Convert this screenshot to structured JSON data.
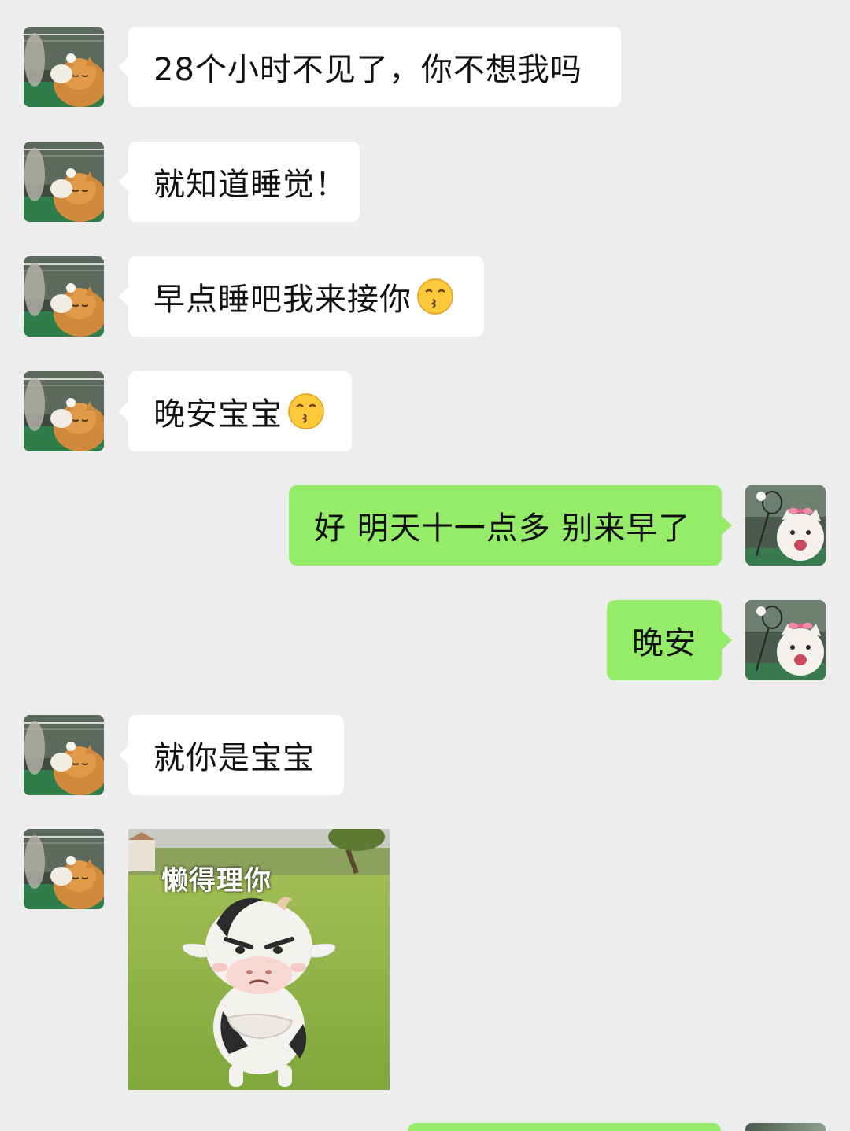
{
  "messages": [
    {
      "sender": "them",
      "text": "28个小时不见了，你不想我吗"
    },
    {
      "sender": "them",
      "text": "就知道睡觉！"
    },
    {
      "sender": "them",
      "text": "早点睡吧我来接你",
      "emoji": "kissing-face-emoji"
    },
    {
      "sender": "them",
      "text": "晚安宝宝",
      "emoji": "kissing-face-emoji"
    },
    {
      "sender": "me",
      "text": "好 明天十一点多 别来早了"
    },
    {
      "sender": "me",
      "text": "晚安"
    },
    {
      "sender": "them",
      "text": "就你是宝宝"
    },
    {
      "sender": "them",
      "type": "sticker",
      "caption": "懒得理你",
      "sticker": "angry-cow-sticker"
    }
  ],
  "avatars": {
    "them": "orange-cat-badminton-avatar",
    "me": "white-cat-pink-bow-avatar"
  },
  "colors": {
    "background": "#ededed",
    "incoming_bubble": "#ffffff",
    "outgoing_bubble": "#95ec69",
    "text": "#111111"
  }
}
